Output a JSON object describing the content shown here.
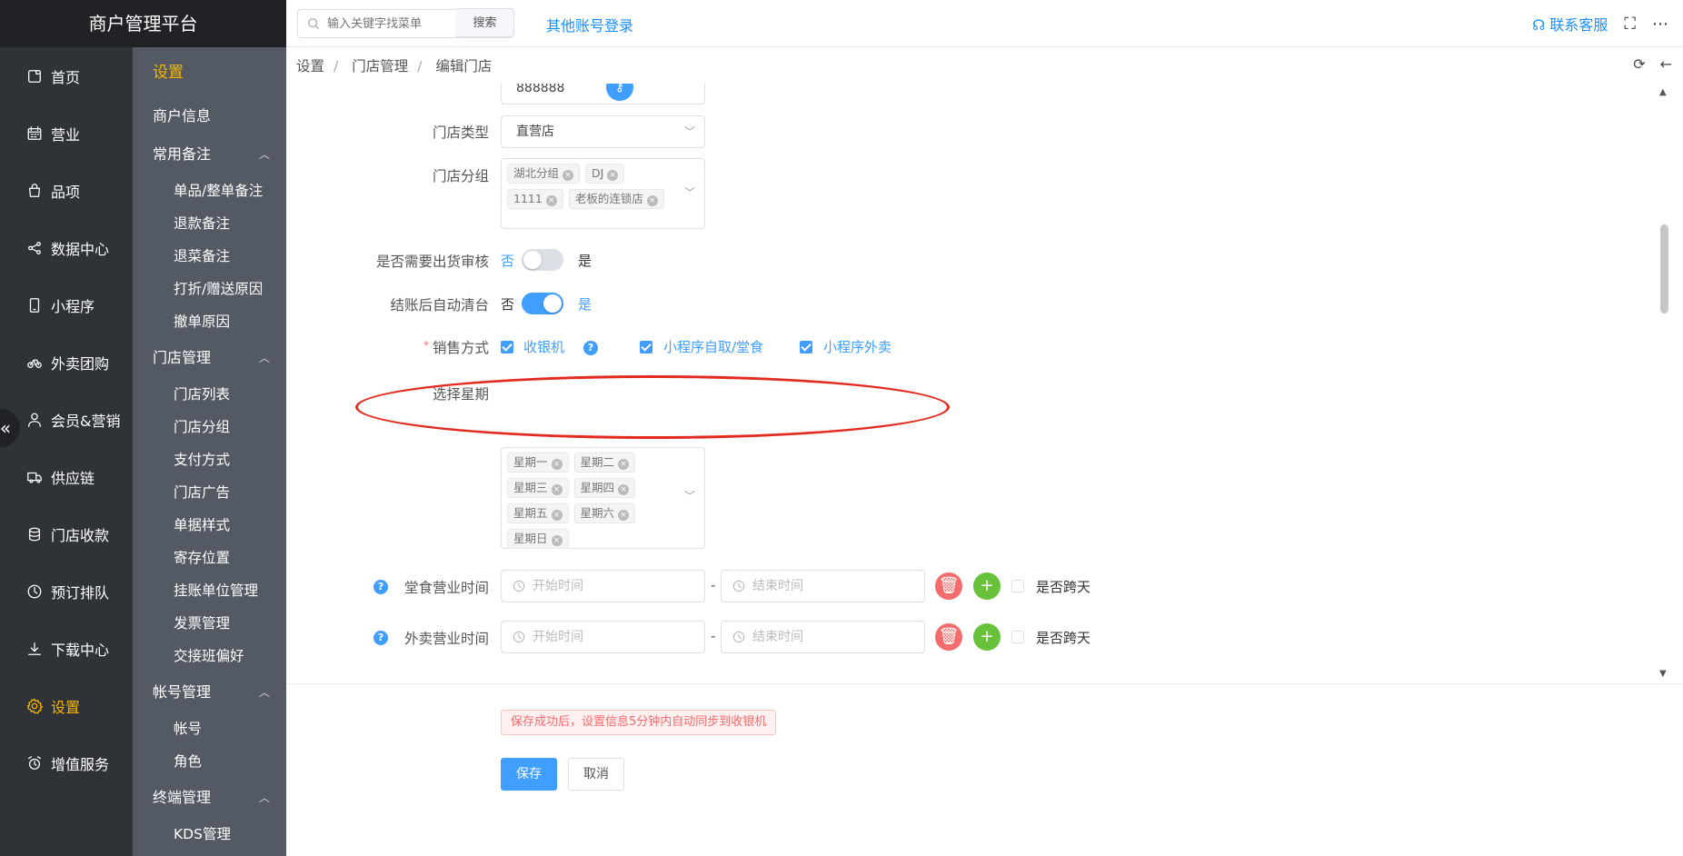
{
  "app": {
    "title": "商户管理平台"
  },
  "nav": {
    "items": [
      {
        "label": "首页",
        "icon": "home-icon"
      },
      {
        "label": "营业",
        "icon": "calendar-icon"
      },
      {
        "label": "品项",
        "icon": "bag-icon"
      },
      {
        "label": "数据中心",
        "icon": "share-icon"
      },
      {
        "label": "小程序",
        "icon": "phone-icon"
      },
      {
        "label": "外卖团购",
        "icon": "bike-icon"
      },
      {
        "label": "会员&营销",
        "icon": "user-icon"
      },
      {
        "label": "供应链",
        "icon": "truck-icon"
      },
      {
        "label": "门店收款",
        "icon": "coins-icon"
      },
      {
        "label": "预订排队",
        "icon": "clock-icon"
      },
      {
        "label": "下载中心",
        "icon": "download-icon"
      },
      {
        "label": "设置",
        "icon": "gear-icon",
        "active": true
      },
      {
        "label": "增值服务",
        "icon": "alarm-icon"
      }
    ]
  },
  "subnav": {
    "title": "设置",
    "merchant_info": "商户信息",
    "sections": [
      {
        "title": "常用备注",
        "items": [
          "单品/整单备注",
          "退款备注",
          "退菜备注",
          "打折/赠送原因",
          "撤单原因"
        ]
      },
      {
        "title": "门店管理",
        "items": [
          "门店列表",
          "门店分组",
          "支付方式",
          "门店广告",
          "单据样式",
          "寄存位置",
          "挂账单位管理",
          "发票管理",
          "交接班偏好"
        ]
      },
      {
        "title": "帐号管理",
        "items": [
          "帐号",
          "角色"
        ]
      },
      {
        "title": "终端管理",
        "items": [
          "KDS管理"
        ]
      }
    ]
  },
  "header": {
    "search_placeholder": "输入关键字找菜单",
    "search_button": "搜索",
    "other_login": "其他账号登录",
    "support": "联系客服"
  },
  "breadcrumb": [
    "设置",
    "门店管理",
    "编辑门店"
  ],
  "form": {
    "code_value": "888888",
    "store_type": {
      "label": "门店类型",
      "value": "直营店"
    },
    "store_group": {
      "label": "门店分组",
      "tags": [
        "湖北分组",
        "DJ",
        "1111",
        "老板的连锁店"
      ]
    },
    "shipping_audit": {
      "label": "是否需要出货审核",
      "no": "否",
      "yes": "是",
      "value": false
    },
    "auto_clear": {
      "label": "结账后自动清台",
      "no": "否",
      "yes": "是",
      "value": true
    },
    "sales_mode": {
      "label": "销售方式",
      "required_mark": "*",
      "options": [
        {
          "label": "收银机",
          "checked": true
        },
        {
          "label": "小程序自取/堂食",
          "checked": true
        },
        {
          "label": "小程序外卖",
          "checked": true
        }
      ]
    },
    "weekdays": {
      "label": "选择星期",
      "tags": [
        "星期一",
        "星期二",
        "星期三",
        "星期四",
        "星期五",
        "星期六",
        "星期日"
      ]
    },
    "dine_hours": {
      "label": "堂食营业时间",
      "start_placeholder": "开始时间",
      "end_placeholder": "结束时间",
      "dash": "-",
      "cross_day": "是否跨天"
    },
    "takeout_hours": {
      "label": "外卖营业时间",
      "start_placeholder": "开始时间",
      "end_placeholder": "结束时间",
      "dash": "-",
      "cross_day": "是否跨天"
    }
  },
  "footer": {
    "notice": "保存成功后，设置信息5分钟内自动同步到收银机",
    "save": "保存",
    "cancel": "取消"
  },
  "colors": {
    "accent": "#409eff",
    "active_nav": "#f7b500",
    "annotation": "#e32a1f"
  }
}
